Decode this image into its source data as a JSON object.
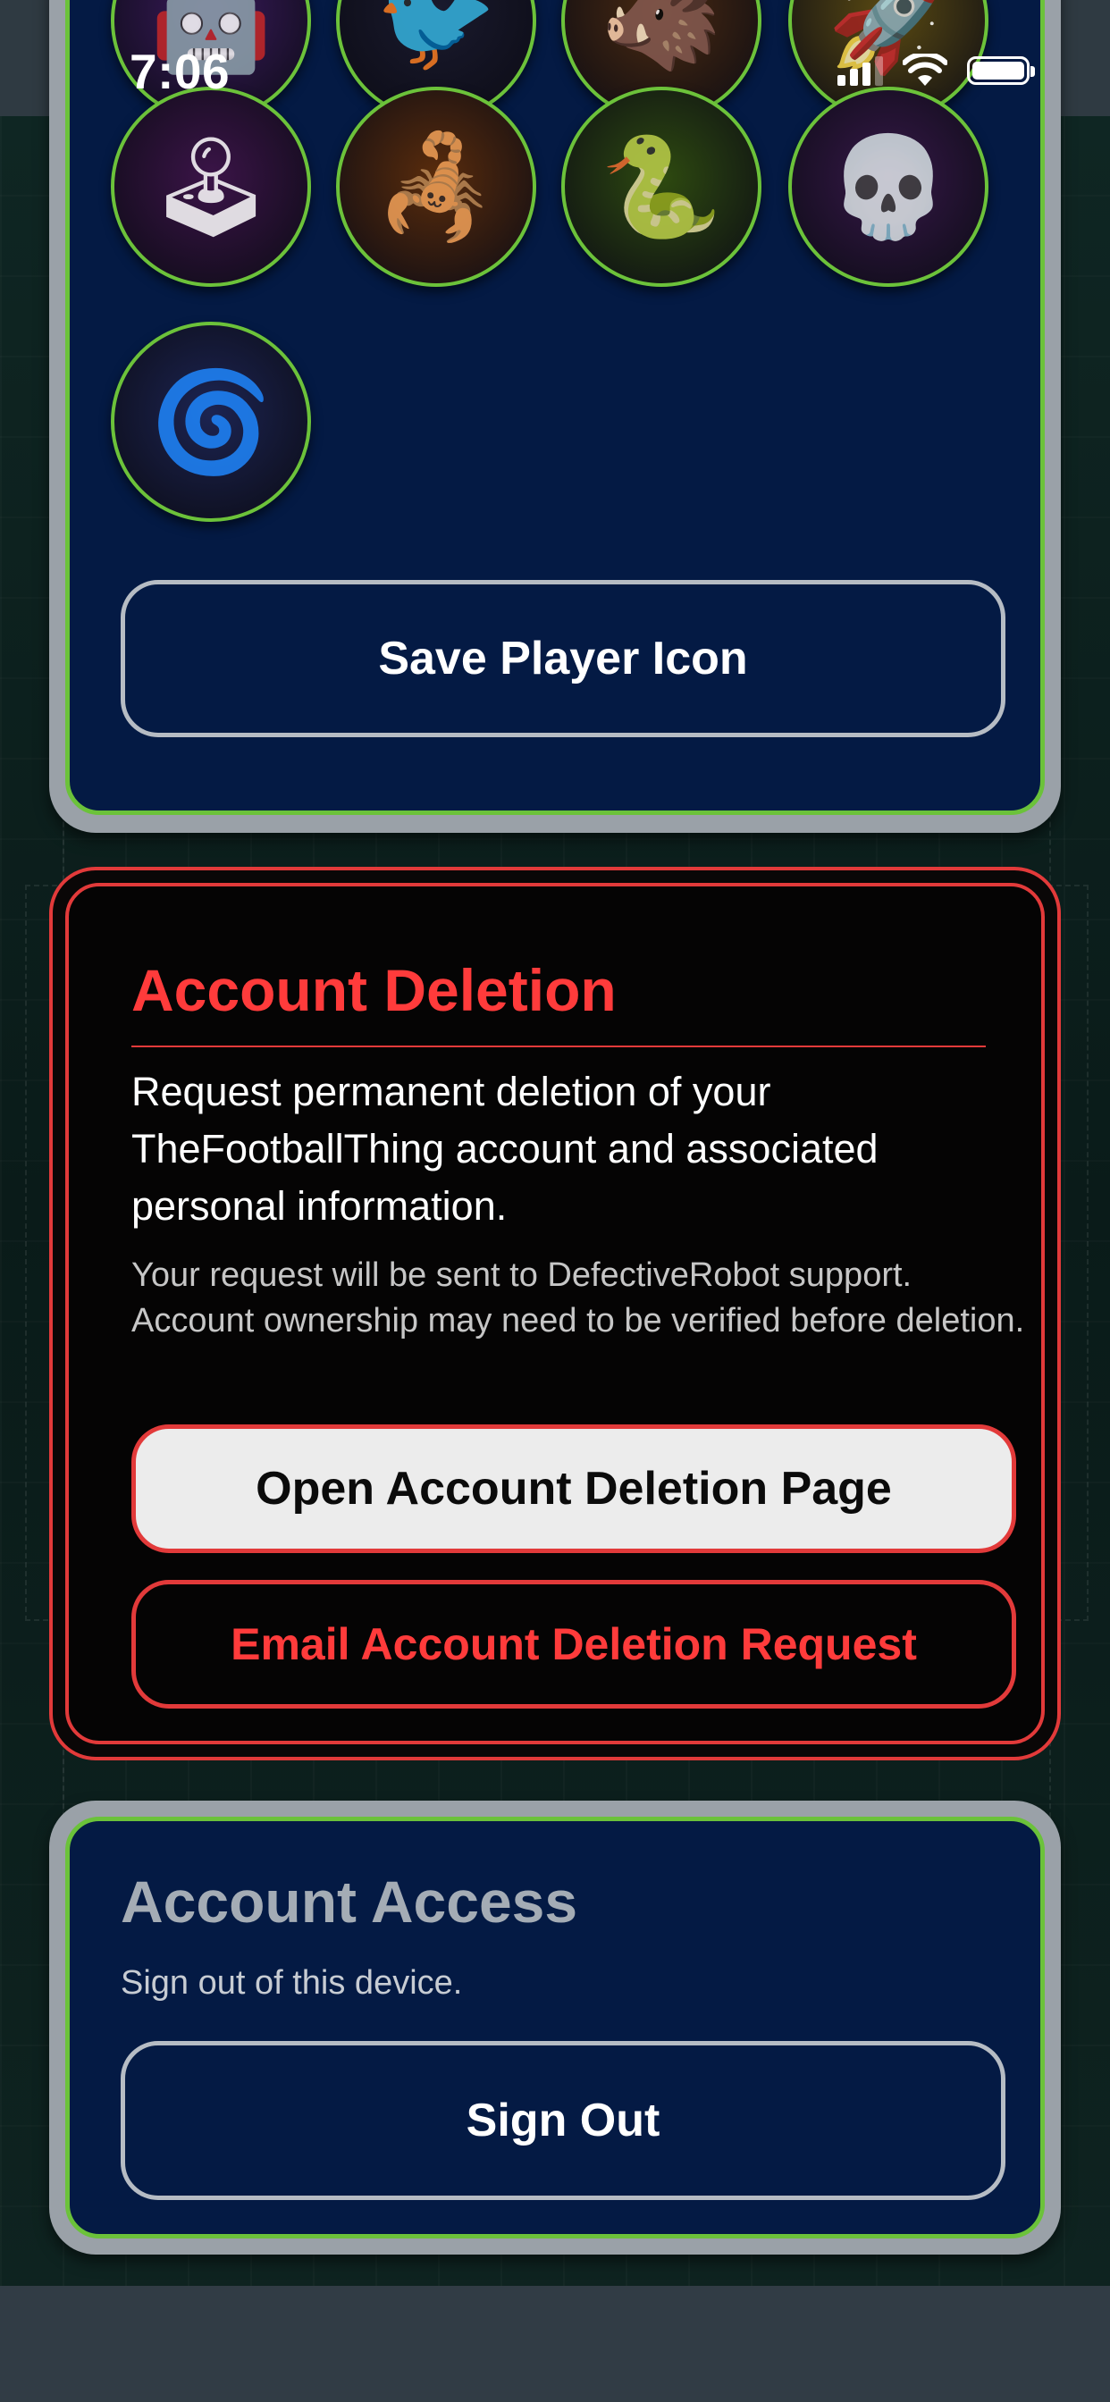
{
  "status_bar": {
    "time": "7:06"
  },
  "player_icons": {
    "items": [
      {
        "name": "robot-avatar-icon",
        "glyph": "🤖",
        "bg": "#3a1a5c"
      },
      {
        "name": "raven-avatar-icon",
        "glyph": "🐦",
        "bg": "#1a1a2e"
      },
      {
        "name": "boar-avatar-icon",
        "glyph": "🐗",
        "bg": "#4a2a10"
      },
      {
        "name": "submarine-avatar-icon",
        "glyph": "🚀",
        "bg": "#5a4a12"
      },
      {
        "name": "arcade-cabinet-avatar-icon",
        "glyph": "🕹",
        "bg": "#3b1448"
      },
      {
        "name": "scorpion-avatar-icon",
        "glyph": "🦂",
        "bg": "#5a2c0c"
      },
      {
        "name": "cobra-avatar-icon",
        "glyph": "🐍",
        "bg": "#2e4a10"
      },
      {
        "name": "bull-skull-avatar-icon",
        "glyph": "💀",
        "bg": "#361848"
      },
      {
        "name": "portal-avatar-icon",
        "glyph": "🌀",
        "bg": "#1c2452"
      }
    ],
    "save_label": "Save Player Icon"
  },
  "account_deletion": {
    "title": "Account Deletion",
    "body": "Request permanent deletion of your TheFootballThing account and associated personal information.",
    "note": "Your request will be sent to DefectiveRobot support. Account ownership may need to be verified before deletion.",
    "open_page_label": "Open Account Deletion Page",
    "email_label": "Email Account Deletion Request"
  },
  "account_access": {
    "title": "Account Access",
    "subtitle": "Sign out of this device.",
    "sign_out_label": "Sign Out"
  },
  "colors": {
    "card_blue": "#041a44",
    "accent_green": "#6bc23a",
    "danger_red": "#ff3b3b"
  }
}
